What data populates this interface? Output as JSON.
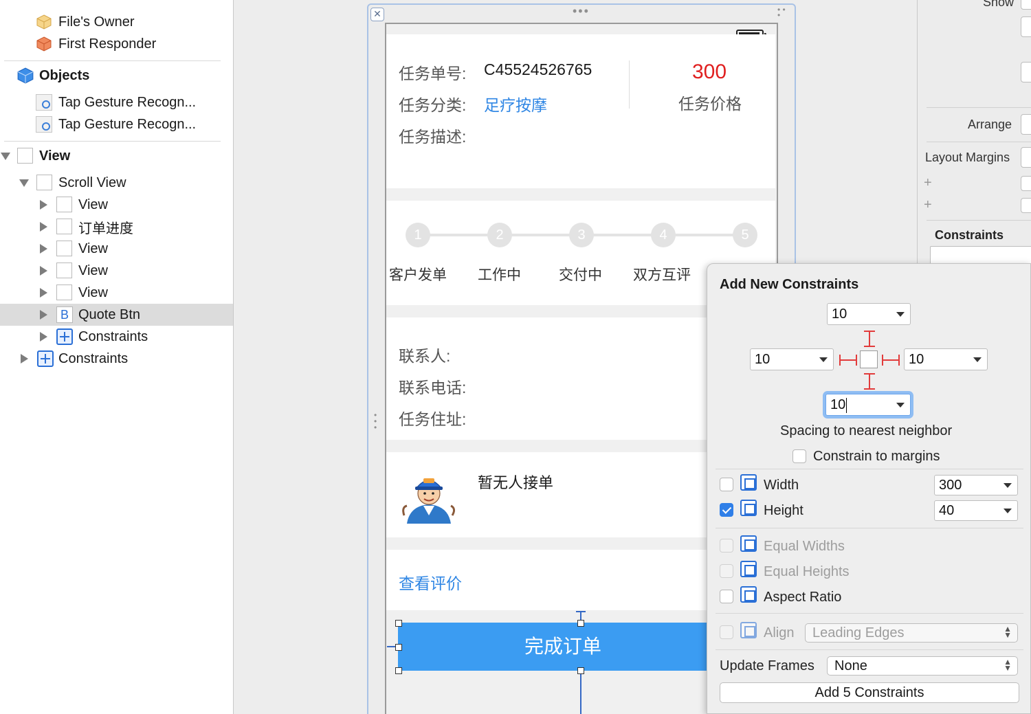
{
  "outline": {
    "files_owner": "File's Owner",
    "first_responder": "First Responder",
    "objects_header": "Objects",
    "tap_gesture_1": "Tap Gesture Recogn...",
    "tap_gesture_2": "Tap Gesture Recogn...",
    "view_root": "View",
    "scroll_view": "Scroll View",
    "child_view_1": "View",
    "order_progress": "订单进度",
    "child_view_2": "View",
    "child_view_3": "View",
    "child_view_4": "View",
    "quote_btn": "Quote Btn",
    "quote_btn_icon": "B",
    "inner_constraints": "Constraints",
    "outer_constraints": "Constraints"
  },
  "canvas": {
    "task_no_label": "任务单号:",
    "task_no_value": "C45524526765",
    "task_category_label": "任务分类:",
    "task_category_value": "足疗按摩",
    "task_desc_label": "任务描述:",
    "price_value": "300",
    "price_label": "任务价格",
    "steps": [
      {
        "num": "1",
        "label": "客户发单"
      },
      {
        "num": "2",
        "label": "工作中"
      },
      {
        "num": "3",
        "label": "交付中"
      },
      {
        "num": "4",
        "label": "双方互评"
      },
      {
        "num": "5",
        "label": ""
      }
    ],
    "contact_label": "联系人:",
    "phone_label": "联系电话:",
    "address_label": "任务住址:",
    "no_taker": "暂无人接单",
    "view_review": "查看评价",
    "complete_order": "完成订单",
    "close_glyph": "✕"
  },
  "inspector": {
    "show": "Show",
    "arrange": "Arrange",
    "layout_margins": "Layout Margins",
    "constraints": "Constraints"
  },
  "popover": {
    "title": "Add New Constraints",
    "top_value": "10",
    "left_value": "10",
    "right_value": "10",
    "bottom_value": "10",
    "spacing_caption": "Spacing to nearest neighbor",
    "constrain_margins": "Constrain to margins",
    "width_label": "Width",
    "width_value": "300",
    "height_label": "Height",
    "height_value": "40",
    "equal_widths": "Equal Widths",
    "equal_heights": "Equal Heights",
    "aspect_ratio": "Aspect Ratio",
    "align_label": "Align",
    "align_value": "Leading Edges",
    "update_frames_label": "Update Frames",
    "update_frames_value": "None",
    "add_button": "Add 5 Constraints"
  }
}
